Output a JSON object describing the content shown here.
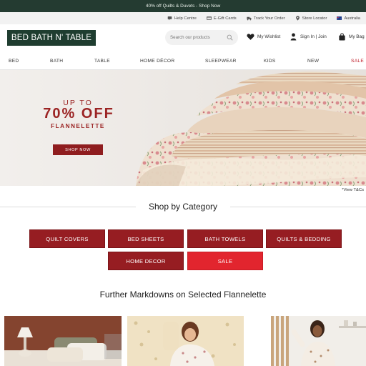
{
  "promo": {
    "text": "40% off Quilts & Duvets - Shop Now"
  },
  "utility": [
    {
      "label": "Help Centre",
      "icon": "chat-icon"
    },
    {
      "label": "E-Gift Cards",
      "icon": "gift-card-icon"
    },
    {
      "label": "Track Your Order",
      "icon": "truck-icon"
    },
    {
      "label": "Store Locator",
      "icon": "location-pin-icon"
    },
    {
      "label": "Australia",
      "icon": "australia-flag-icon"
    }
  ],
  "header": {
    "logo": "BED BATH N' TABLE",
    "search_placeholder": "Search our products",
    "wishlist": "My Wishlist",
    "signin": "Sign In | Join",
    "bag": "My Bag"
  },
  "nav": [
    "BED",
    "BATH",
    "TABLE",
    "HOME DÉCOR",
    "SLEEPWEAR",
    "KIDS",
    "NEW",
    "SALE"
  ],
  "hero": {
    "line1": "UP TO",
    "line2": "70% OFF",
    "line3": "FLANNELETTE",
    "cta": "SHOP NOW",
    "terms": "*View T&Cs"
  },
  "category": {
    "title": "Shop by Category",
    "buttons": [
      "QUILT COVERS",
      "BED SHEETS",
      "BATH TOWELS",
      "QUILTS & BEDDING",
      "HOME DECOR",
      "SALE"
    ]
  },
  "markdowns": {
    "title": "Further Markdowns on Selected Flannelette"
  },
  "colors": {
    "brand_green": "#1f3d30",
    "promo_green": "#243b31",
    "brand_red": "#961d22",
    "sale_red": "#e2252e"
  }
}
